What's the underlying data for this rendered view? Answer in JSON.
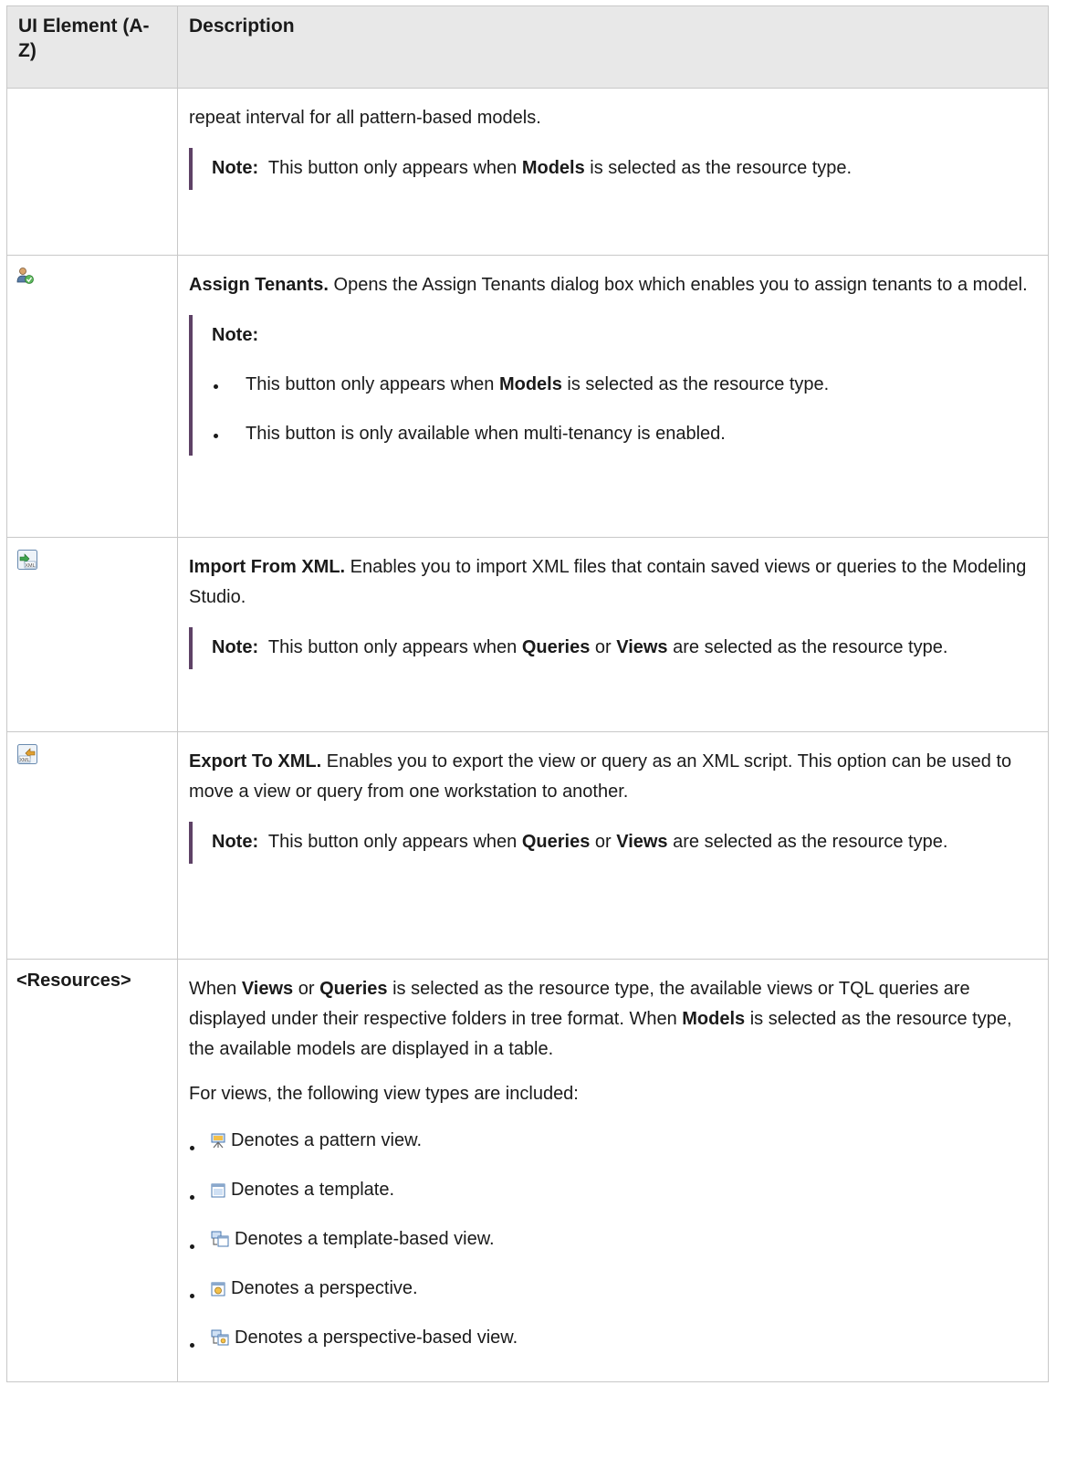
{
  "header": {
    "col1": "UI Element (A-Z)",
    "col2": "Description"
  },
  "rows": [
    {
      "element": "",
      "desc_text": "repeat interval for all pattern-based models.",
      "note": {
        "label": "Note:",
        "t1": "This button only appears when ",
        "b1": "Models",
        "t2": " is selected as the resource type."
      }
    },
    {
      "element_icon": "assign-tenants-icon",
      "title": "Assign Tenants.",
      "desc_text": " Opens the Assign Tenants dialog box which enables you to assign tenants to a model.",
      "note": {
        "label": "Note:",
        "items": [
          {
            "t1": "This button only appears when ",
            "b1": "Models",
            "t2": " is selected as the resource type."
          },
          {
            "t1": "This button is only available when multi-tenancy is enabled."
          }
        ]
      }
    },
    {
      "element_icon": "import-from-xml-icon",
      "title": "Import From XML.",
      "desc_text": " Enables you to import XML files that contain saved views or queries to the Modeling Studio.",
      "note": {
        "label": "Note:",
        "t1": "This button only appears when ",
        "b1": "Queries",
        "t2": " or ",
        "b2": "Views",
        "t3": " are selected as the resource type."
      }
    },
    {
      "element_icon": "export-to-xml-icon",
      "title": "Export To XML.",
      "desc_text": " Enables you to export the view or query as an XML script. This option can be used to move a view or query from one workstation to another.",
      "note": {
        "label": "Note:",
        "t1": "This button only appears when ",
        "b1": "Queries",
        "t2": " or ",
        "b2": "Views",
        "t3": " are selected as the resource type."
      }
    },
    {
      "element": "<Resources>",
      "p1": {
        "t1": "When ",
        "b1": "Views",
        "t2": " or ",
        "b2": "Queries",
        "t3": " is selected as the resource type, the available views or TQL queries are displayed under their respective folders in tree format. When ",
        "b3": "Models",
        "t4": " is selected as the resource type, the available models are displayed in a table."
      },
      "p2": "For views, the following view types are included:",
      "types": [
        {
          "icon": "pattern-view-icon",
          "text": "Denotes a pattern view."
        },
        {
          "icon": "template-icon",
          "text": "Denotes a template."
        },
        {
          "icon": "template-based-view-icon",
          "text": "Denotes a template-based view."
        },
        {
          "icon": "perspective-icon",
          "text": "Denotes a perspective."
        },
        {
          "icon": "perspective-based-view-icon",
          "text": "Denotes a perspective-based view."
        }
      ]
    }
  ]
}
